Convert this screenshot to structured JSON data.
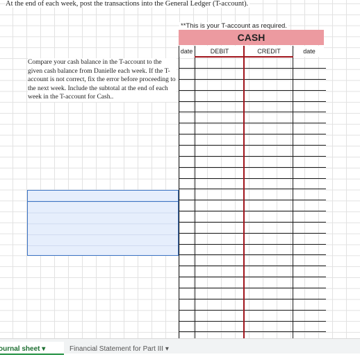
{
  "sheet": {
    "header": "At the end of each week, post the transactions into the General Ledger (T-account).",
    "note": "**This is your T-account as required.",
    "instruction": "Compare your cash balance in the T-account to the given cash balance from Danielle each week. If the T-account is not correct, fix the error before proceeding to the next week. Include the subtotal at the end of each week in the T-account for Cash.."
  },
  "taccount": {
    "title": "CASH",
    "columns": {
      "date_left": "date",
      "debit": "DEBIT",
      "credit": "CREDIT",
      "date_right": "date"
    },
    "rows": 25
  },
  "tabs": {
    "active": "ournal sheet",
    "other": "Financial Statement for Part III"
  },
  "colors": {
    "title_bg": "#ec9aa0",
    "center_line": "#a0141c",
    "selection": "#e6eefc"
  }
}
